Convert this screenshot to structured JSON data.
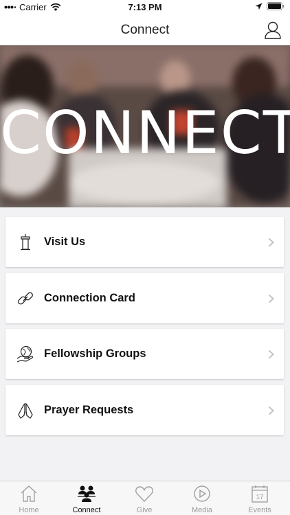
{
  "status_bar": {
    "carrier": "Carrier",
    "time": "7:13 PM"
  },
  "nav": {
    "title": "Connect"
  },
  "hero": {
    "title": "CONNECT"
  },
  "menu": [
    {
      "label": "Visit Us",
      "icon": "podium-icon"
    },
    {
      "label": "Connection Card",
      "icon": "link-icon"
    },
    {
      "label": "Fellowship Groups",
      "icon": "globe-hand-icon"
    },
    {
      "label": "Prayer Requests",
      "icon": "praying-hands-icon"
    }
  ],
  "tabs": [
    {
      "label": "Home",
      "icon": "home-icon",
      "active": false
    },
    {
      "label": "Connect",
      "icon": "people-icon",
      "active": true
    },
    {
      "label": "Give",
      "icon": "heart-icon",
      "active": false
    },
    {
      "label": "Media",
      "icon": "play-icon",
      "active": false
    },
    {
      "label": "Events",
      "icon": "calendar-icon",
      "active": false
    }
  ],
  "calendar_day": "17"
}
